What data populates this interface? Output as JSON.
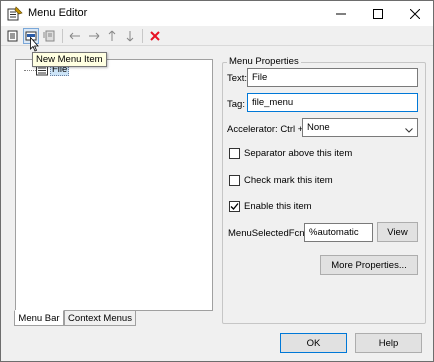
{
  "window": {
    "title": "Menu Editor"
  },
  "toolbar": {
    "tooltip": "New Menu Item",
    "buttons": [
      "new-menu-icon",
      "new-menu-item-icon",
      "new-context-menu-icon",
      "move-left-icon",
      "move-right-icon",
      "move-up-icon",
      "move-down-icon",
      "delete-icon"
    ]
  },
  "tree": {
    "node_label": "File"
  },
  "tabs": {
    "menu_bar": "Menu Bar",
    "context_menus": "Context Menus"
  },
  "properties": {
    "title": "Menu Properties",
    "text_label": "Text:",
    "text_value": "File",
    "tag_label": "Tag:",
    "tag_value": "file_menu",
    "accelerator_label": "Accelerator: Ctrl +",
    "accelerator_value": "None",
    "separator_label": "Separator above this item",
    "separator_checked": false,
    "checkmark_label": "Check mark this item",
    "checkmark_checked": false,
    "enable_label": "Enable this item",
    "enable_checked": true,
    "callback_label": "MenuSelectedFcn:",
    "callback_value": "%automatic",
    "view_label": "View",
    "more_label": "More Properties..."
  },
  "footer": {
    "ok_label": "OK",
    "help_label": "Help"
  },
  "colors": {
    "accent": "#0078d7",
    "delete": "#e81123",
    "selection": "#cce4f7"
  }
}
